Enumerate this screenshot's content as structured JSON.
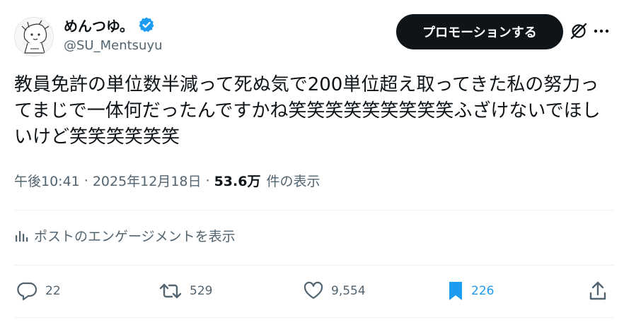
{
  "author": {
    "display_name": "めんつゆ。",
    "handle": "@SU_Mentsuyu",
    "verified": true
  },
  "header": {
    "promote_label": "プロモーションする"
  },
  "post": {
    "text": "教員免許の単位数半減って死ぬ気で200単位超え取ってきた私の努力ってまじで一体何だったんですかね笑笑笑笑笑笑笑笑笑ふざけないでほしいけど笑笑笑笑笑笑"
  },
  "meta": {
    "time": "午後10:41",
    "separator": "·",
    "date": "2025年12月18日",
    "views_count": "53.6万",
    "views_label": "件の表示"
  },
  "engagement_label": "ポストのエンゲージメントを表示",
  "actions": {
    "replies": "22",
    "reposts": "529",
    "likes": "9,554",
    "bookmarks": "226"
  },
  "colors": {
    "accent": "#1d9bf0",
    "text": "#0f1419",
    "muted": "#536471",
    "divider": "#eff3f4"
  },
  "icons": [
    "avatar-illustration",
    "verified-badge-icon",
    "grok-icon",
    "more-icon",
    "analytics-icon",
    "reply-icon",
    "repost-icon",
    "like-icon",
    "bookmark-icon",
    "share-icon"
  ]
}
